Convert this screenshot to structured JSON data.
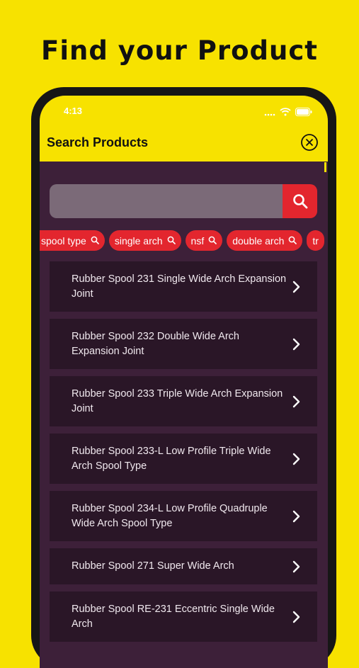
{
  "headline": "Find your Product",
  "status": {
    "time": "4:13"
  },
  "header": {
    "title": "Search Products"
  },
  "search": {
    "value": "",
    "placeholder": ""
  },
  "chips": [
    {
      "label": "spool type"
    },
    {
      "label": "single arch"
    },
    {
      "label": "nsf"
    },
    {
      "label": "double arch"
    },
    {
      "label": "tr"
    }
  ],
  "products": [
    {
      "name": "Rubber Spool 231 Single Wide Arch Expansion Joint"
    },
    {
      "name": "Rubber Spool 232 Double Wide Arch Expansion Joint"
    },
    {
      "name": "Rubber Spool 233 Triple Wide Arch Expansion Joint"
    },
    {
      "name": "Rubber Spool 233-L Low Profile Triple Wide Arch Spool Type"
    },
    {
      "name": "Rubber Spool 234-L Low Profile Quadruple Wide Arch Spool Type"
    },
    {
      "name": "Rubber Spool 271 Super Wide Arch"
    },
    {
      "name": "Rubber Spool RE-231 Eccentric Single Wide Arch"
    }
  ],
  "colors": {
    "brand_yellow": "#f7e200",
    "accent_red": "#e3262e",
    "panel": "#3d2039",
    "card": "#2a1627"
  }
}
